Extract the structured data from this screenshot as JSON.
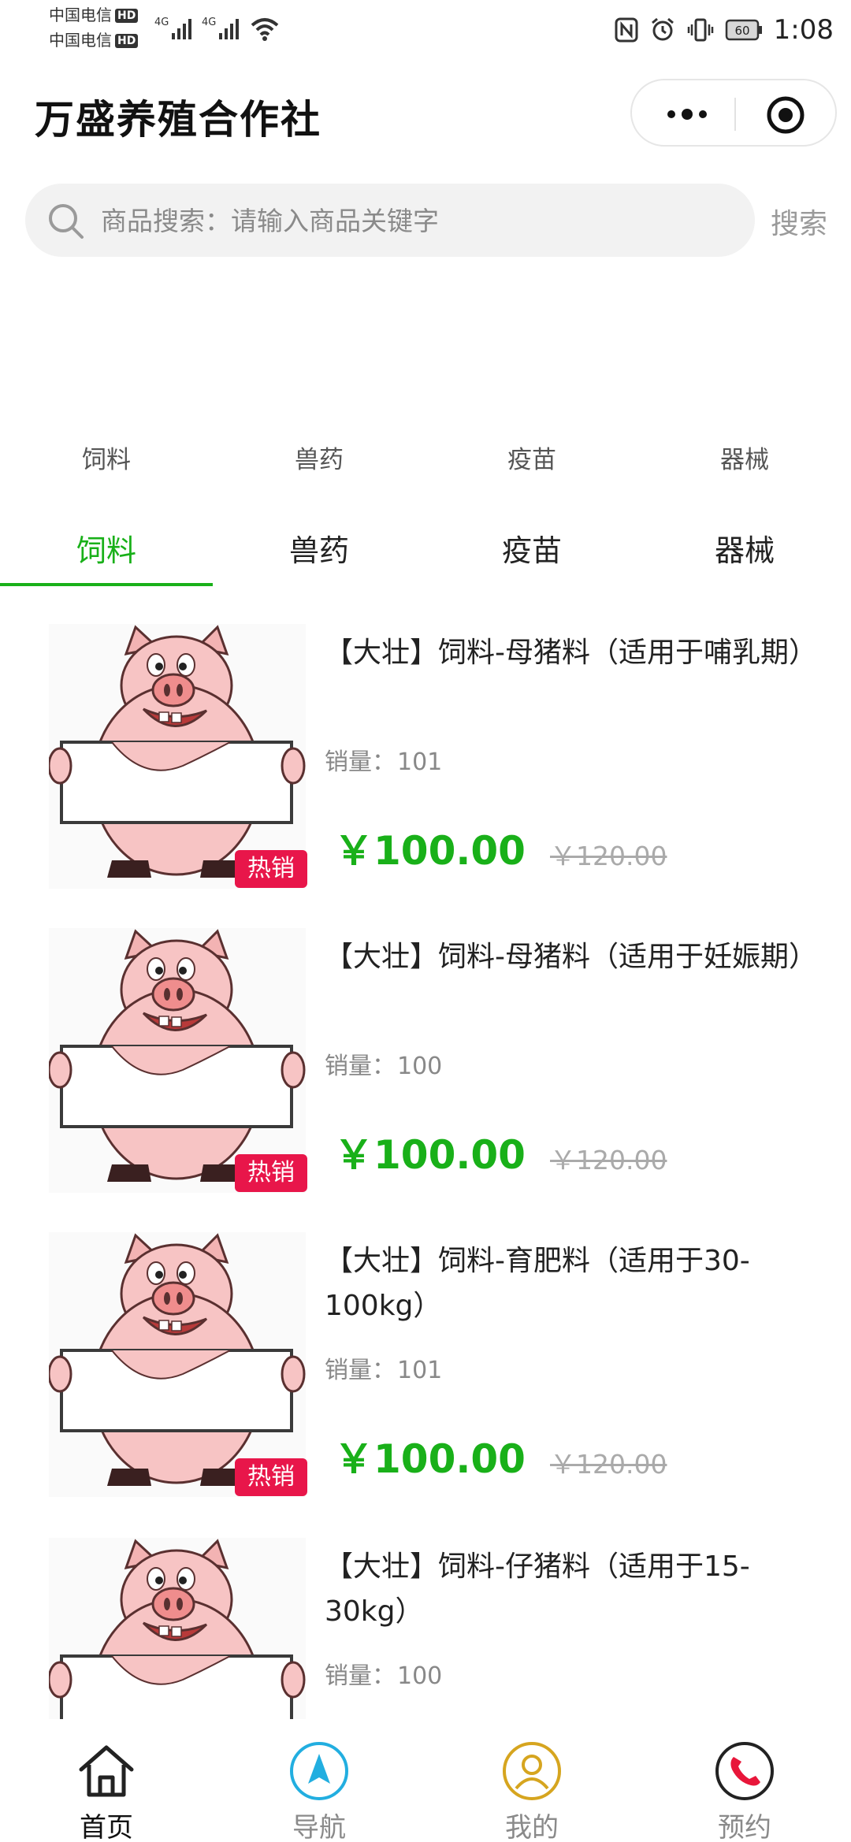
{
  "status_bar": {
    "carrier1": "中国电信",
    "carrier2": "中国电信",
    "hd": "HD",
    "network1": "4G",
    "network2": "4G",
    "battery": "60",
    "time": "1:08"
  },
  "header": {
    "title": "万盛养殖合作社"
  },
  "search": {
    "placeholder": "商品搜索：请输入商品关键字",
    "button_label": "搜索"
  },
  "category_grid": [
    "饲料",
    "兽药",
    "疫苗",
    "器械"
  ],
  "tabs": [
    {
      "label": "饲料",
      "active": true
    },
    {
      "label": "兽药",
      "active": false
    },
    {
      "label": "疫苗",
      "active": false
    },
    {
      "label": "器械",
      "active": false
    }
  ],
  "products": [
    {
      "name": "【大壮】饲料-母猪料（适用于哺乳期）",
      "sales_label": "销量：",
      "sales": "101",
      "price": "￥100.00",
      "original_price": "￥120.00",
      "badge": "热销"
    },
    {
      "name": "【大壮】饲料-母猪料（适用于妊娠期）",
      "sales_label": "销量：",
      "sales": "100",
      "price": "￥100.00",
      "original_price": "￥120.00",
      "badge": "热销"
    },
    {
      "name": "【大壮】饲料-育肥料（适用于30-100kg）",
      "sales_label": "销量：",
      "sales": "101",
      "price": "￥100.00",
      "original_price": "￥120.00",
      "badge": "热销"
    },
    {
      "name": "【大壮】饲料-仔猪料（适用于15-30kg）",
      "sales_label": "销量：",
      "sales": "100",
      "price": "",
      "original_price": "",
      "badge": ""
    }
  ],
  "bottom_nav": [
    {
      "label": "首页",
      "icon": "home-icon",
      "active": true
    },
    {
      "label": "导航",
      "icon": "navigation-icon",
      "active": false
    },
    {
      "label": "我的",
      "icon": "user-icon",
      "active": false
    },
    {
      "label": "预约",
      "icon": "phone-icon",
      "active": false
    }
  ],
  "colors": {
    "accent_green": "#19b019",
    "badge_red": "#e8164a",
    "nav_blue": "#22aee0",
    "nav_gold": "#d6a51f",
    "nav_red": "#e8163a"
  }
}
